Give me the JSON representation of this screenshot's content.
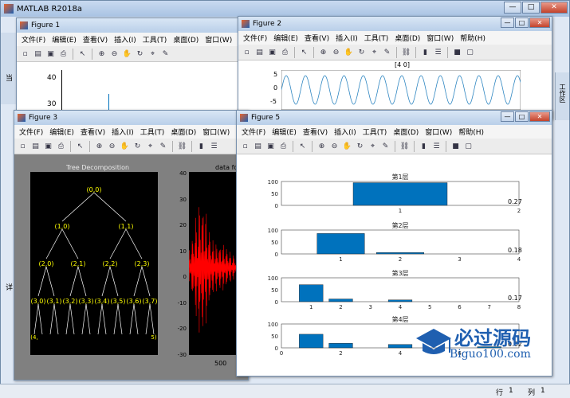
{
  "main": {
    "title": "MATLAB R2018a"
  },
  "menus": [
    "文件(F)",
    "编辑(E)",
    "查看(V)",
    "插入(I)",
    "工具(T)",
    "桌面(D)",
    "窗口(W)",
    "帮助(H)"
  ],
  "fig1": {
    "title": "Figure 1",
    "yticks": [
      "40",
      "30"
    ]
  },
  "fig2": {
    "title": "Figure 2",
    "plot_title": "[4 0]",
    "yticks": [
      "5",
      "0",
      "-5"
    ]
  },
  "fig3": {
    "title": "Figure 3",
    "tree_title": "Tree Decomposition",
    "data_title": "data fo",
    "yticks": [
      "40",
      "30",
      "20",
      "10",
      "0",
      "-10",
      "-20",
      "-30"
    ],
    "xtick": "500",
    "nodes": [
      "(0,0)",
      "(1,0)",
      "(1,1)",
      "(2,0)",
      "(2,1)",
      "(2,2)",
      "(2,3)",
      "(3,0)",
      "(3,1)",
      "(3,2)",
      "(3,3)",
      "(3,4)",
      "(3,5)",
      "(3,6)",
      "(3,7)",
      "(4,",
      "5)"
    ]
  },
  "fig5": {
    "title": "Figure 5",
    "panels": [
      {
        "title": "第1层",
        "yticks": [
          "100",
          "50",
          "0"
        ],
        "xticks": [
          "1",
          "2"
        ],
        "xmax": 2,
        "bars": [
          {
            "x": 1,
            "v": 100
          }
        ],
        "label": "0.27"
      },
      {
        "title": "第2层",
        "yticks": [
          "100",
          "50",
          "0"
        ],
        "xticks": [
          "1",
          "2",
          "3",
          "4"
        ],
        "xmax": 4,
        "bars": [
          {
            "x": 1,
            "v": 90
          },
          {
            "x": 2,
            "v": 6
          }
        ],
        "label": "0.18"
      },
      {
        "title": "第3层",
        "yticks": [
          "100",
          "50",
          "0"
        ],
        "xticks": [
          "1",
          "2",
          "3",
          "4",
          "5",
          "6",
          "7",
          "8"
        ],
        "xmax": 8,
        "bars": [
          {
            "x": 1,
            "v": 75
          },
          {
            "x": 2,
            "v": 12
          },
          {
            "x": 4,
            "v": 8
          }
        ],
        "label": "0.17"
      },
      {
        "title": "第4层",
        "yticks": [
          "100",
          "50",
          "0"
        ],
        "xticks": [
          "0",
          "2",
          "4",
          "6"
        ],
        "xmax": 8,
        "bars": [
          {
            "x": 1,
            "v": 60
          },
          {
            "x": 2,
            "v": 20
          },
          {
            "x": 4,
            "v": 15
          },
          {
            "x": 7,
            "v": 5
          }
        ],
        "label": "0.02"
      }
    ]
  },
  "status": {
    "row_label": "行",
    "row_value": "1",
    "col_label": "列",
    "col_value": "1"
  },
  "side": {
    "left_tab": "当",
    "right_tab": "工作区",
    "detail": "详"
  },
  "watermark": {
    "main": "必过源码",
    "sub": "Biguo100.com"
  },
  "colors": {
    "bar": "#0072bd",
    "signal": "#ff0000",
    "node_text": "#ffff00",
    "line": "#2e86c1"
  }
}
